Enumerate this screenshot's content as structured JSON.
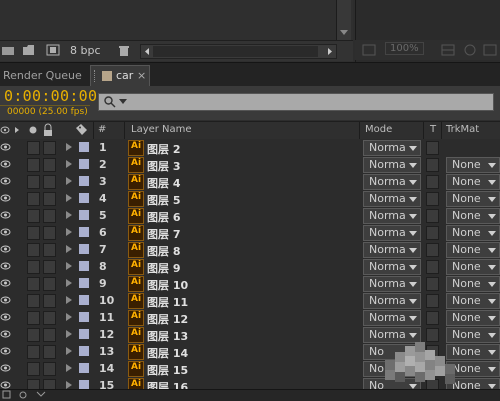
{
  "project_panel": {
    "bpc_label": "8 bpc",
    "zoom_label": "100%"
  },
  "tabs": [
    {
      "label": "Render Queue"
    },
    {
      "label": "car"
    }
  ],
  "timeline": {
    "timecode": "0:00:00:00",
    "frame_fps": "00000 (25.00 fps)",
    "search_placeholder": ""
  },
  "columns": {
    "number": "#",
    "layer_name": "Layer Name",
    "mode": "Mode",
    "t": "T",
    "trkmat": "TrkMat"
  },
  "colors": {
    "timecode": "#e8b000",
    "label_lavender": "#aab0cf"
  },
  "layers": [
    {
      "num": "1",
      "name": "图层 2",
      "mode": "Norma",
      "trkmat": ""
    },
    {
      "num": "2",
      "name": "图层 3",
      "mode": "Norma",
      "trkmat": "None"
    },
    {
      "num": "3",
      "name": "图层 4",
      "mode": "Norma",
      "trkmat": "None"
    },
    {
      "num": "4",
      "name": "图层 5",
      "mode": "Norma",
      "trkmat": "None"
    },
    {
      "num": "5",
      "name": "图层 6",
      "mode": "Norma",
      "trkmat": "None"
    },
    {
      "num": "6",
      "name": "图层 7",
      "mode": "Norma",
      "trkmat": "None"
    },
    {
      "num": "7",
      "name": "图层 8",
      "mode": "Norma",
      "trkmat": "None"
    },
    {
      "num": "8",
      "name": "图层 9",
      "mode": "Norma",
      "trkmat": "None"
    },
    {
      "num": "9",
      "name": "图层 10",
      "mode": "Norma",
      "trkmat": "None"
    },
    {
      "num": "10",
      "name": "图层 11",
      "mode": "Norma",
      "trkmat": "None"
    },
    {
      "num": "11",
      "name": "图层 12",
      "mode": "Norma",
      "trkmat": "None"
    },
    {
      "num": "12",
      "name": "图层 13",
      "mode": "Norma",
      "trkmat": "None"
    },
    {
      "num": "13",
      "name": "图层 14",
      "mode": "No",
      "trkmat": "None"
    },
    {
      "num": "14",
      "name": "图层 15",
      "mode": "No",
      "trkmat": "None"
    },
    {
      "num": "15",
      "name": "图层 16",
      "mode": "No",
      "trkmat": "None"
    }
  ]
}
